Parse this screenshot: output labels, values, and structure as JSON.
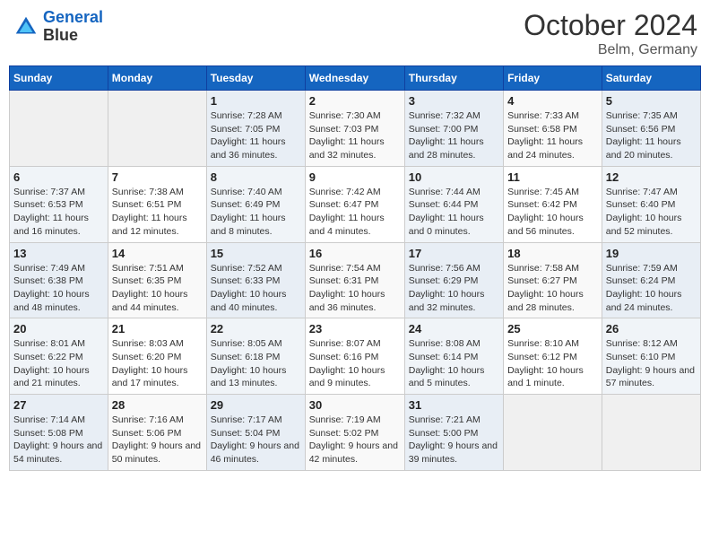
{
  "header": {
    "logo_line1": "General",
    "logo_line2": "Blue",
    "month_year": "October 2024",
    "location": "Belm, Germany"
  },
  "weekdays": [
    "Sunday",
    "Monday",
    "Tuesday",
    "Wednesday",
    "Thursday",
    "Friday",
    "Saturday"
  ],
  "weeks": [
    [
      {
        "day": "",
        "info": ""
      },
      {
        "day": "",
        "info": ""
      },
      {
        "day": "1",
        "info": "Sunrise: 7:28 AM\nSunset: 7:05 PM\nDaylight: 11 hours and 36 minutes."
      },
      {
        "day": "2",
        "info": "Sunrise: 7:30 AM\nSunset: 7:03 PM\nDaylight: 11 hours and 32 minutes."
      },
      {
        "day": "3",
        "info": "Sunrise: 7:32 AM\nSunset: 7:00 PM\nDaylight: 11 hours and 28 minutes."
      },
      {
        "day": "4",
        "info": "Sunrise: 7:33 AM\nSunset: 6:58 PM\nDaylight: 11 hours and 24 minutes."
      },
      {
        "day": "5",
        "info": "Sunrise: 7:35 AM\nSunset: 6:56 PM\nDaylight: 11 hours and 20 minutes."
      }
    ],
    [
      {
        "day": "6",
        "info": "Sunrise: 7:37 AM\nSunset: 6:53 PM\nDaylight: 11 hours and 16 minutes."
      },
      {
        "day": "7",
        "info": "Sunrise: 7:38 AM\nSunset: 6:51 PM\nDaylight: 11 hours and 12 minutes."
      },
      {
        "day": "8",
        "info": "Sunrise: 7:40 AM\nSunset: 6:49 PM\nDaylight: 11 hours and 8 minutes."
      },
      {
        "day": "9",
        "info": "Sunrise: 7:42 AM\nSunset: 6:47 PM\nDaylight: 11 hours and 4 minutes."
      },
      {
        "day": "10",
        "info": "Sunrise: 7:44 AM\nSunset: 6:44 PM\nDaylight: 11 hours and 0 minutes."
      },
      {
        "day": "11",
        "info": "Sunrise: 7:45 AM\nSunset: 6:42 PM\nDaylight: 10 hours and 56 minutes."
      },
      {
        "day": "12",
        "info": "Sunrise: 7:47 AM\nSunset: 6:40 PM\nDaylight: 10 hours and 52 minutes."
      }
    ],
    [
      {
        "day": "13",
        "info": "Sunrise: 7:49 AM\nSunset: 6:38 PM\nDaylight: 10 hours and 48 minutes."
      },
      {
        "day": "14",
        "info": "Sunrise: 7:51 AM\nSunset: 6:35 PM\nDaylight: 10 hours and 44 minutes."
      },
      {
        "day": "15",
        "info": "Sunrise: 7:52 AM\nSunset: 6:33 PM\nDaylight: 10 hours and 40 minutes."
      },
      {
        "day": "16",
        "info": "Sunrise: 7:54 AM\nSunset: 6:31 PM\nDaylight: 10 hours and 36 minutes."
      },
      {
        "day": "17",
        "info": "Sunrise: 7:56 AM\nSunset: 6:29 PM\nDaylight: 10 hours and 32 minutes."
      },
      {
        "day": "18",
        "info": "Sunrise: 7:58 AM\nSunset: 6:27 PM\nDaylight: 10 hours and 28 minutes."
      },
      {
        "day": "19",
        "info": "Sunrise: 7:59 AM\nSunset: 6:24 PM\nDaylight: 10 hours and 24 minutes."
      }
    ],
    [
      {
        "day": "20",
        "info": "Sunrise: 8:01 AM\nSunset: 6:22 PM\nDaylight: 10 hours and 21 minutes."
      },
      {
        "day": "21",
        "info": "Sunrise: 8:03 AM\nSunset: 6:20 PM\nDaylight: 10 hours and 17 minutes."
      },
      {
        "day": "22",
        "info": "Sunrise: 8:05 AM\nSunset: 6:18 PM\nDaylight: 10 hours and 13 minutes."
      },
      {
        "day": "23",
        "info": "Sunrise: 8:07 AM\nSunset: 6:16 PM\nDaylight: 10 hours and 9 minutes."
      },
      {
        "day": "24",
        "info": "Sunrise: 8:08 AM\nSunset: 6:14 PM\nDaylight: 10 hours and 5 minutes."
      },
      {
        "day": "25",
        "info": "Sunrise: 8:10 AM\nSunset: 6:12 PM\nDaylight: 10 hours and 1 minute."
      },
      {
        "day": "26",
        "info": "Sunrise: 8:12 AM\nSunset: 6:10 PM\nDaylight: 9 hours and 57 minutes."
      }
    ],
    [
      {
        "day": "27",
        "info": "Sunrise: 7:14 AM\nSunset: 5:08 PM\nDaylight: 9 hours and 54 minutes."
      },
      {
        "day": "28",
        "info": "Sunrise: 7:16 AM\nSunset: 5:06 PM\nDaylight: 9 hours and 50 minutes."
      },
      {
        "day": "29",
        "info": "Sunrise: 7:17 AM\nSunset: 5:04 PM\nDaylight: 9 hours and 46 minutes."
      },
      {
        "day": "30",
        "info": "Sunrise: 7:19 AM\nSunset: 5:02 PM\nDaylight: 9 hours and 42 minutes."
      },
      {
        "day": "31",
        "info": "Sunrise: 7:21 AM\nSunset: 5:00 PM\nDaylight: 9 hours and 39 minutes."
      },
      {
        "day": "",
        "info": ""
      },
      {
        "day": "",
        "info": ""
      }
    ]
  ]
}
